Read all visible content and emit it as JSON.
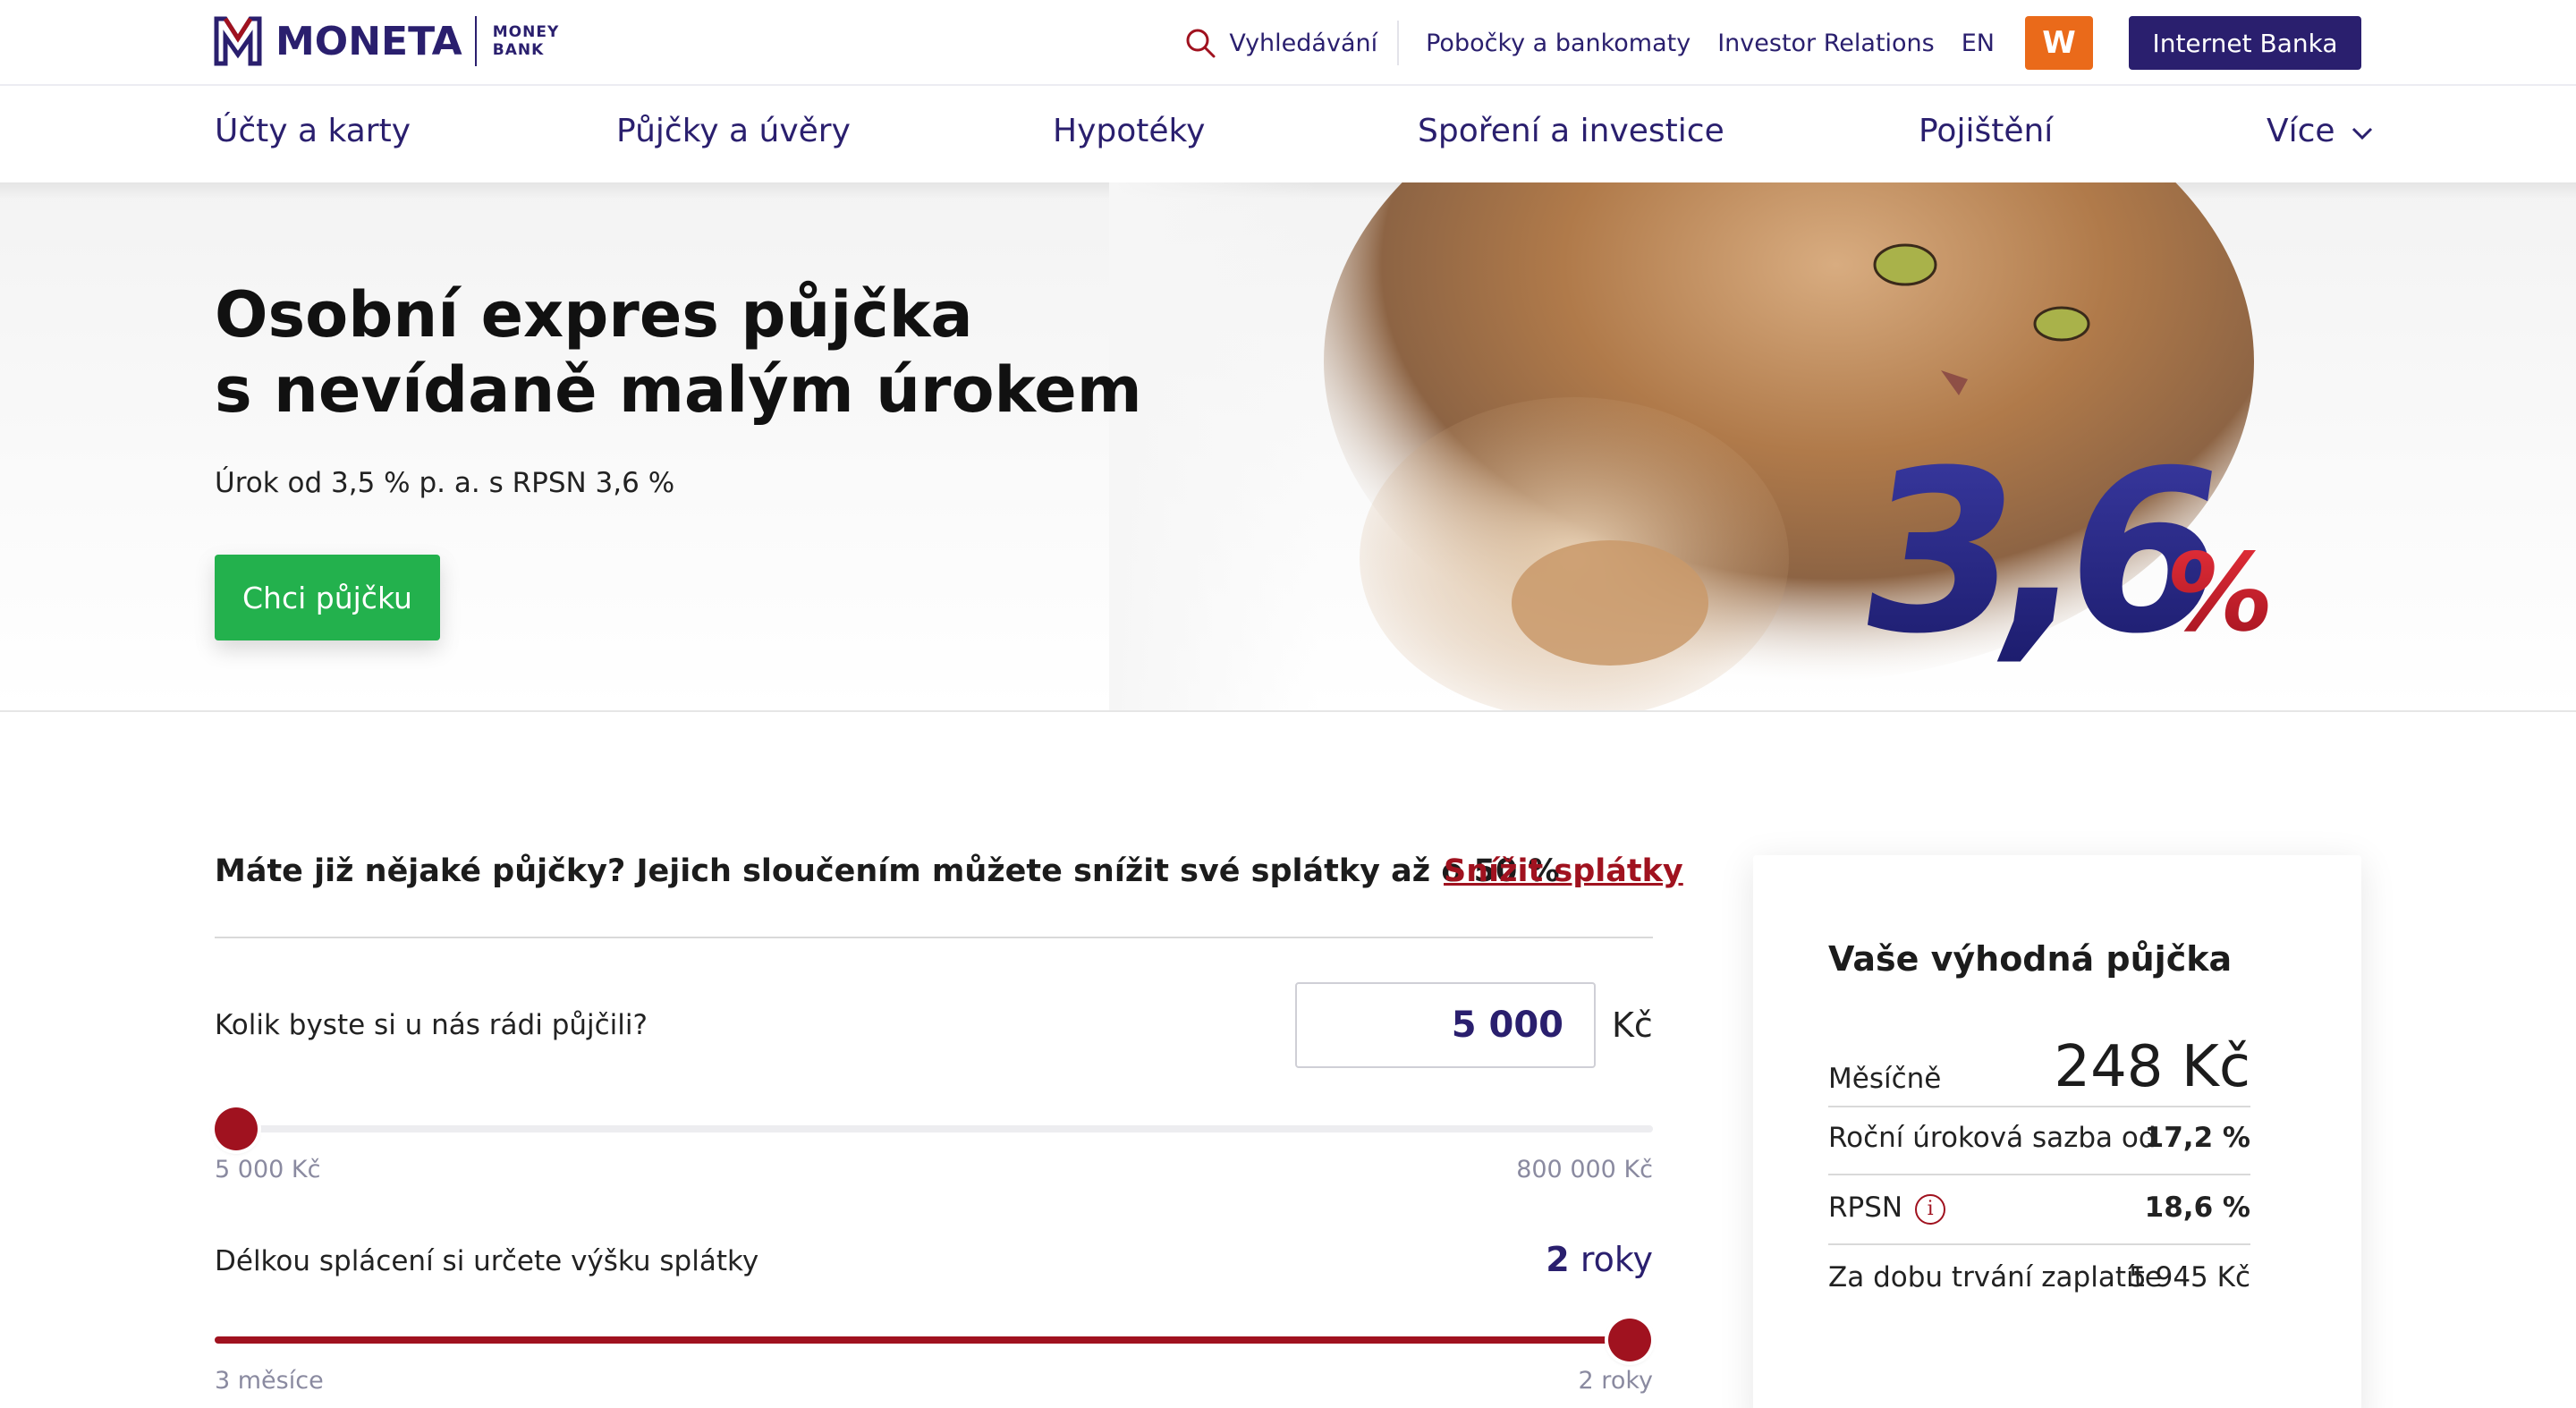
{
  "brand": {
    "name": "MONETA",
    "sub_line1": "MONEY",
    "sub_line2": "BANK",
    "color_primary": "#2a1f6e",
    "color_accent": "#a0121f"
  },
  "topnav": {
    "search_label": "Vyhledávání",
    "branches_label": "Pobočky a bankomaty",
    "investor_label": "Investor Relations",
    "lang_label": "EN",
    "w_label": "W",
    "internet_banking_label": "Internet Banka"
  },
  "mainnav": {
    "items": [
      "Účty a karty",
      "Půjčky a úvěry",
      "Hypotéky",
      "Spoření a investice",
      "Pojištění"
    ],
    "more_label": "Více"
  },
  "hero": {
    "title_line1": "Osobní expres půjčka",
    "title_line2": "s nevídaně malým úrokem",
    "subtitle": "Úrok od 3,5 % p. a. s RPSN 3,6 %",
    "cta_label": "Chci půjčku",
    "badge_big": "3,6",
    "badge_pct": "%"
  },
  "calculator": {
    "promo_text": "Máte již nějaké půjčky? Jejich sloučením můžete snížit své splátky až o 50 %",
    "promo_link": "Snížit splátky",
    "amount_question": "Kolik byste si u nás rádi půjčili?",
    "amount_value": "5 000",
    "amount_unit": "Kč",
    "amount_min": "5 000 Kč",
    "amount_max": "800 000 Kč",
    "amount_slider_fraction": 0,
    "term_question": "Délkou splácení si určete výšku splátky",
    "term_value_num": "2",
    "term_value_unit": "roky",
    "term_min": "3 měsíce",
    "term_max": "2 roky",
    "term_slider_fraction": 1
  },
  "summary": {
    "title": "Vaše výhodná půjčka",
    "monthly_label": "Měsíčně",
    "monthly_value": "248 Kč",
    "rate_label": "Roční úroková sazba od",
    "rate_value": "17,2 %",
    "rpsn_label": "RPSN",
    "rpsn_value": "18,6 %",
    "total_label": "Za dobu trvání zaplatíte",
    "total_value": "5 945 Kč"
  }
}
